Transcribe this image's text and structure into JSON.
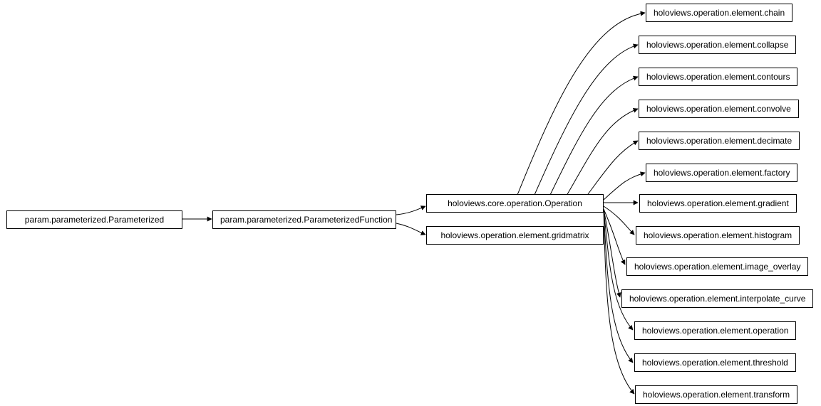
{
  "nodes": {
    "param_parameterized": {
      "label": "param.parameterized.Parameterized"
    },
    "param_parameterized_function": {
      "label": "param.parameterized.ParameterizedFunction"
    },
    "core_operation": {
      "label": "holoviews.core.operation.Operation"
    },
    "gridmatrix": {
      "label": "holoviews.operation.element.gridmatrix"
    },
    "chain": {
      "label": "holoviews.operation.element.chain"
    },
    "collapse": {
      "label": "holoviews.operation.element.collapse"
    },
    "contours": {
      "label": "holoviews.operation.element.contours"
    },
    "convolve": {
      "label": "holoviews.operation.element.convolve"
    },
    "decimate": {
      "label": "holoviews.operation.element.decimate"
    },
    "factory": {
      "label": "holoviews.operation.element.factory"
    },
    "gradient": {
      "label": "holoviews.operation.element.gradient"
    },
    "histogram": {
      "label": "holoviews.operation.element.histogram"
    },
    "image_overlay": {
      "label": "holoviews.operation.element.image_overlay"
    },
    "interpolate_curve": {
      "label": "holoviews.operation.element.interpolate_curve"
    },
    "operation": {
      "label": "holoviews.operation.element.operation"
    },
    "threshold": {
      "label": "holoviews.operation.element.threshold"
    },
    "transform": {
      "label": "holoviews.operation.element.transform"
    }
  }
}
